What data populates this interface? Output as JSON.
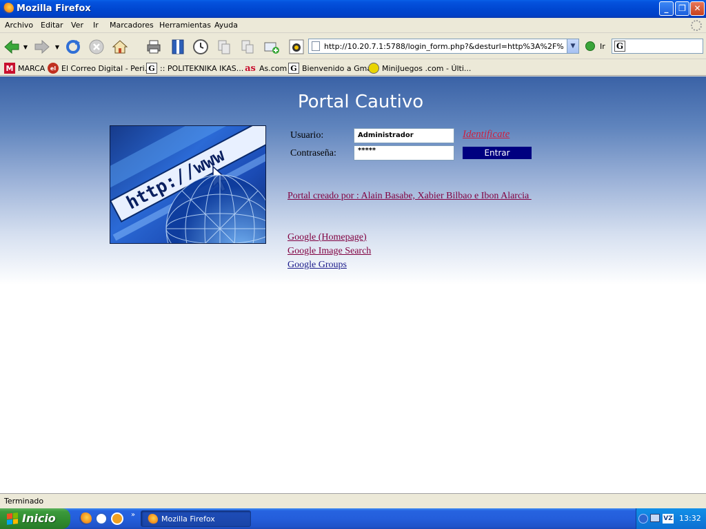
{
  "window": {
    "title": "Mozilla Firefox"
  },
  "menu": [
    "Archivo",
    "Editar",
    "Ver",
    "Ir",
    "Marcadores",
    "Herramientas",
    "Ayuda"
  ],
  "toolbar": {
    "url": "http://10.20.7.1:5788/login_form.php?&desturl=http%3A%2F%2Fwww",
    "go_label": "Ir"
  },
  "bookmarks": [
    {
      "label": "MARCA",
      "icon": "M"
    },
    {
      "label": "El Correo Digital - Peri...",
      "icon": "el"
    },
    {
      "label": ":: POLITEKNIKA IKAS...",
      "icon": "G"
    },
    {
      "label": "As.com",
      "icon": "as"
    },
    {
      "label": "Bienvenido a Gmail",
      "icon": "G"
    },
    {
      "label": "MiniJuegos .com - Últi...",
      "icon": ""
    }
  ],
  "page": {
    "title": "Portal Cautivo",
    "usuario_label": "Usuario:",
    "password_label": "Contraseña:",
    "usuario_value": "Administrador",
    "password_value": "*****",
    "identificate": "Identificate",
    "entrar": "Entrar",
    "credit": "Portal creado por : Alain Basabe, Xabier Bilbao e Ibon Alarcia ",
    "links": [
      "Google (Homepage)",
      "Google Image Search",
      "Google Groups"
    ],
    "hero_text": "http://www"
  },
  "status": "Terminado",
  "taskbar": {
    "start": "Inicio",
    "task": "Mozilla Firefox",
    "tray_icon_label": "VZ",
    "clock": "13:32"
  },
  "colors": {
    "accent": "#0047d1",
    "link": "#800040",
    "identificate": "#cc1f3e",
    "entrar_bg": "#000080"
  }
}
